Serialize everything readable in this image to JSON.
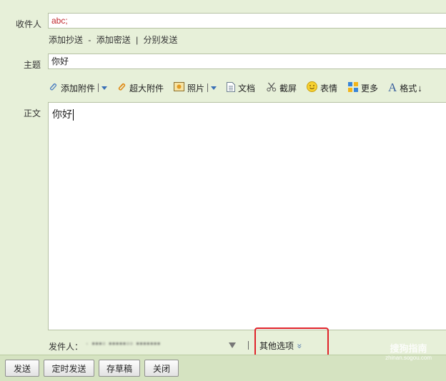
{
  "form": {
    "to_label": "收件人",
    "to_value": "abc;",
    "cc_link": "添加抄送",
    "dash": "-",
    "bcc_link": "添加密送",
    "bar": "|",
    "separate_send_link": "分别发送",
    "subject_label": "主题",
    "subject_value": "你好",
    "body_label": "正文",
    "body_value": "你好"
  },
  "toolbar": {
    "attach": "添加附件",
    "big_attach": "超大附件",
    "photo": "照片",
    "document": "文档",
    "screenshot": "截屏",
    "emoji": "表情",
    "more": "更多",
    "format": "格式",
    "format_arrow": "↓"
  },
  "sender": {
    "label": "发件人：",
    "value": "· ▪▪▪▫ ▪▪▪▪▪▫▫ ▪▪▪▪▪▪▪",
    "other_options": "其他选项",
    "other_options_icon": "»"
  },
  "actions": {
    "send": "发送",
    "scheduled_send": "定时发送",
    "save_draft": "存草稿",
    "close": "关闭"
  },
  "watermark": {
    "text": "搜狗指南",
    "url": "zhinan.sogou.com"
  },
  "colors": {
    "background": "#e7f0d9",
    "recipient_text": "#c0282d",
    "highlight_border": "#e0232a"
  }
}
